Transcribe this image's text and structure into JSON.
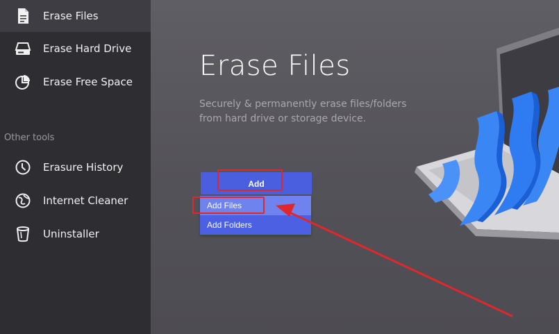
{
  "sidebar": {
    "items": [
      {
        "label": "Erase Files",
        "icon": "document-icon",
        "active": true
      },
      {
        "label": "Erase Hard Drive",
        "icon": "hard-drive-icon",
        "active": false
      },
      {
        "label": "Erase Free Space",
        "icon": "pie-chart-icon",
        "active": false
      }
    ],
    "section_label": "Other tools",
    "tools": [
      {
        "label": "Erasure History",
        "icon": "clock-icon"
      },
      {
        "label": "Internet Cleaner",
        "icon": "globe-icon"
      },
      {
        "label": "Uninstaller",
        "icon": "trash-icon"
      }
    ]
  },
  "main": {
    "title": "Erase Files",
    "subtitle": "Securely & permanently erase files/folders from hard drive or storage device.",
    "add_button_label": "Add",
    "menu": [
      {
        "label": "Add Files",
        "hovered": true
      },
      {
        "label": "Add Folders",
        "hovered": false
      }
    ]
  },
  "colors": {
    "sidebar_bg": "#2e2d32",
    "sidebar_active_bg": "#3e3d43",
    "main_bg": "#55545a",
    "accent_blue": "#4a5fe0",
    "menu_hover": "#6f83ef",
    "annotation_red": "#e0272b"
  }
}
